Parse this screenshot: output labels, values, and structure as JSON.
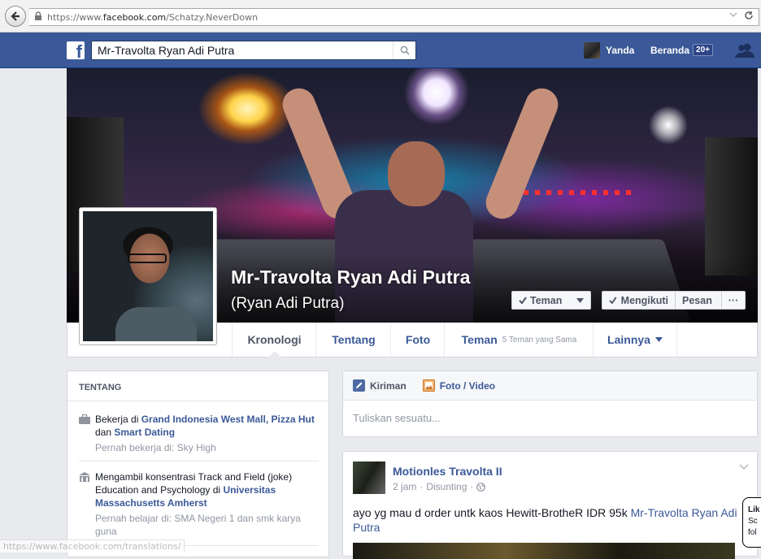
{
  "browser": {
    "url_prefix": "https://www.",
    "url_domain": "facebook.com",
    "url_path": "/Schatzy.NeverDown",
    "status_url": "https://www.facebook.com/translations/"
  },
  "topbar": {
    "logo": "f",
    "search_value": "Mr-Travolta Ryan Adi Putra",
    "user_name": "Yanda",
    "home_label": "Beranda",
    "home_badge": "20+"
  },
  "profile": {
    "name": "Mr-Travolta Ryan Adi Putra",
    "alt_name": "(Ryan Adi Putra)",
    "buttons": {
      "friend": "Teman",
      "following": "Mengikuti",
      "message": "Pesan",
      "more": "···"
    }
  },
  "tabs": {
    "timeline": "Kronologi",
    "about": "Tentang",
    "photos": "Foto",
    "friends": "Teman",
    "friends_sub": "5 Teman yang Sama",
    "more": "Lainnya"
  },
  "about": {
    "title": "TENTANG",
    "work": {
      "pre": "Bekerja di ",
      "place1": "Grand Indonesia West Mall, Pizza Hut",
      "mid": " dan ",
      "place2": "Smart Dating",
      "past": "Pernah bekerja di: Sky High"
    },
    "education": {
      "pre": "Mengambil konsentrasi Track and Field (joke) Education and Psychology di ",
      "school": "Universitas Massachusetts Amherst",
      "past": "Pernah belajar di: SMA Negeri 1 dan smk karya guna"
    }
  },
  "composer": {
    "tab_post": "Kiriman",
    "tab_photo": "Foto / Video",
    "placeholder": "Tuliskan sesuatu..."
  },
  "post": {
    "author": "Motionles Travolta II",
    "time": "2 jam",
    "edited": "Disunting",
    "text": "ayo yg mau d order untk kaos Hewitt-BrotheR IDR 95k ",
    "mention": "Mr-Travolta Ryan Adi Putra"
  },
  "tooltip": {
    "title": "Lik",
    "line1": "Sc",
    "line2": "fol"
  },
  "colors": {
    "brand": "#3b5998",
    "link": "#3b5998",
    "page_bg": "#e9eaed"
  }
}
